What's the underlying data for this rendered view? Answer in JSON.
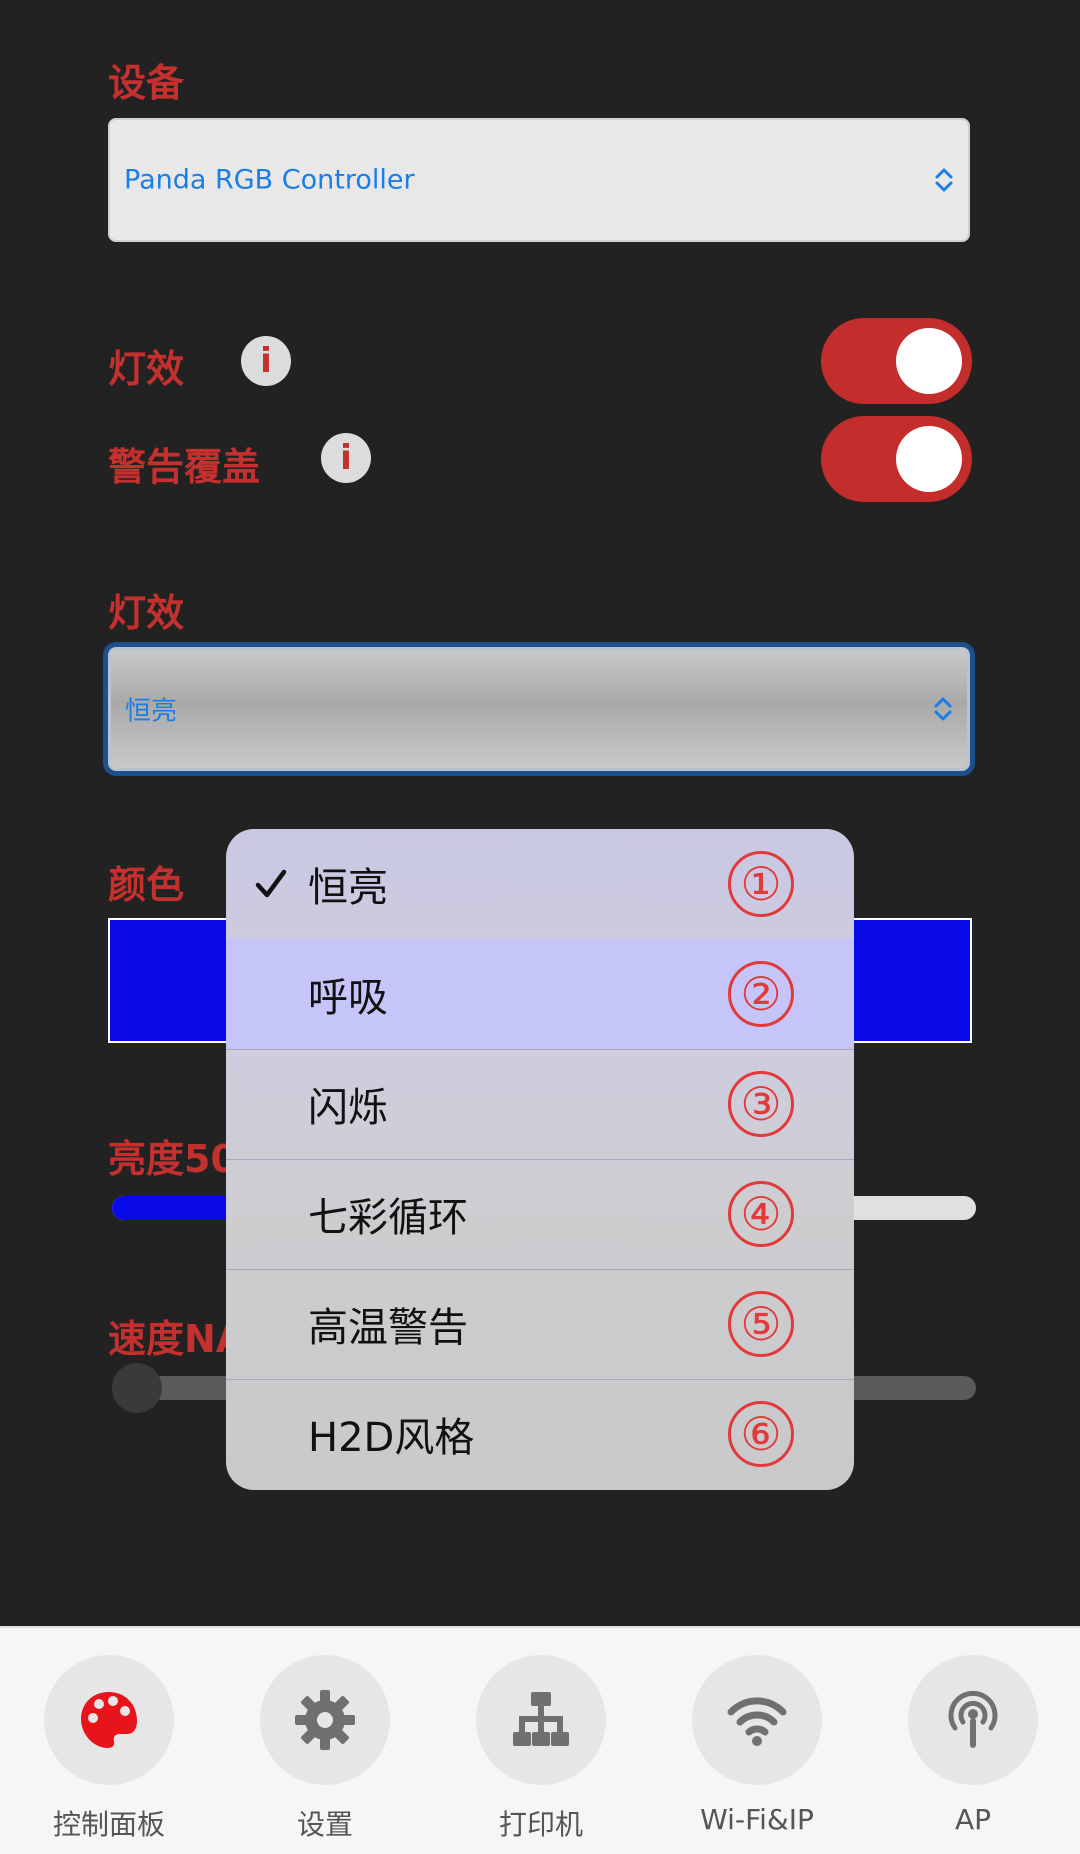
{
  "device": {
    "label": "设备",
    "selected": "Panda RGB Controller"
  },
  "effect_toggle": {
    "label": "灯效",
    "info": "i",
    "on": true
  },
  "warning_toggle": {
    "label": "警告覆盖",
    "info": "i",
    "on": true
  },
  "effect_select": {
    "label": "灯效",
    "selected": "恒亮"
  },
  "color": {
    "label": "颜色",
    "value": "#0a0ae8"
  },
  "brightness": {
    "label_visible": "亮度50",
    "value_percent": 50
  },
  "speed": {
    "label_visible": "速度NA"
  },
  "menu": {
    "items": [
      {
        "label": "恒亮",
        "number": "①",
        "checked": true
      },
      {
        "label": "呼吸",
        "number": "②",
        "checked": false
      },
      {
        "label": "闪烁",
        "number": "③",
        "checked": false
      },
      {
        "label": "七彩循环",
        "number": "④",
        "checked": false
      },
      {
        "label": "高温警告",
        "number": "⑤",
        "checked": false
      },
      {
        "label": "H2D风格",
        "number": "⑥",
        "checked": false
      }
    ]
  },
  "tabs": [
    {
      "label": "控制面板",
      "icon": "palette-icon",
      "active": true
    },
    {
      "label": "设置",
      "icon": "gear-icon",
      "active": false
    },
    {
      "label": "打印机",
      "icon": "network-tree-icon",
      "active": false
    },
    {
      "label": "Wi-Fi&IP",
      "icon": "wifi-icon",
      "active": false
    },
    {
      "label": "AP",
      "icon": "antenna-icon",
      "active": false
    }
  ],
  "colors": {
    "accent_red": "#c3302e",
    "link_blue": "#1a7ee6",
    "background": "#222223",
    "menu_number": "#e23a3a"
  }
}
